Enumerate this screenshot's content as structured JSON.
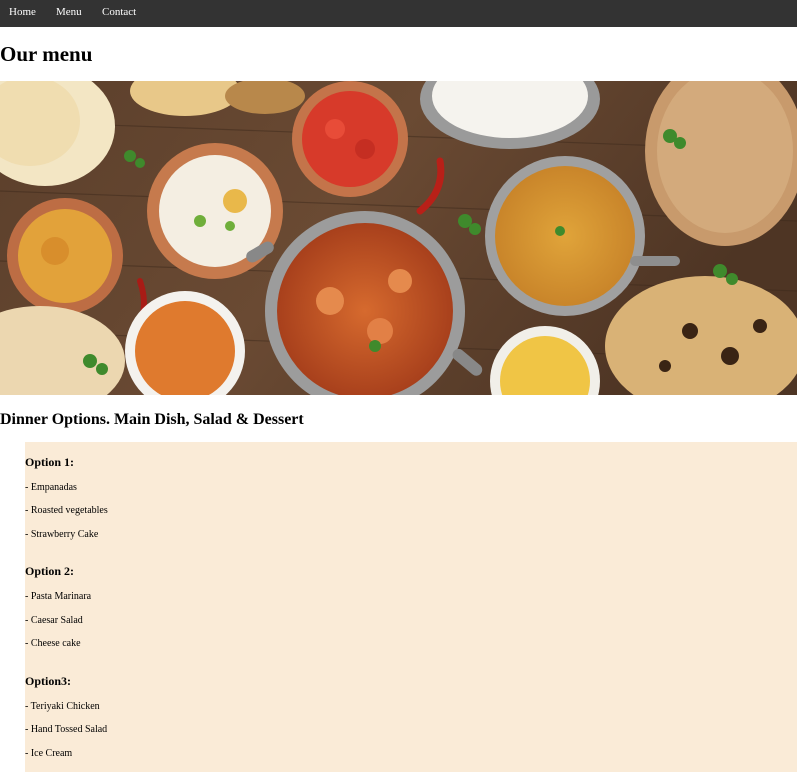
{
  "nav": {
    "home": "Home",
    "menu": "Menu",
    "contact": "Contact"
  },
  "page_title": "Our menu",
  "subtitle": "Dinner Options. Main Dish, Salad & Dessert",
  "options": [
    {
      "title": "Option 1:",
      "items": [
        "- Empanadas",
        "- Roasted vegetables",
        "- Strawberry Cake"
      ]
    },
    {
      "title": "Option 2:",
      "items": [
        "- Pasta Marinara",
        "- Caesar Salad",
        "- Cheese cake"
      ]
    },
    {
      "title": "Option3:",
      "items": [
        "- Teriyaki Chicken",
        "- Hand Tossed Salad",
        "- Ice Cream"
      ]
    }
  ],
  "colors": {
    "nav_bg": "#333333",
    "menu_bg": "#faebd7"
  },
  "banner_image": "indian-food-spread-photo"
}
